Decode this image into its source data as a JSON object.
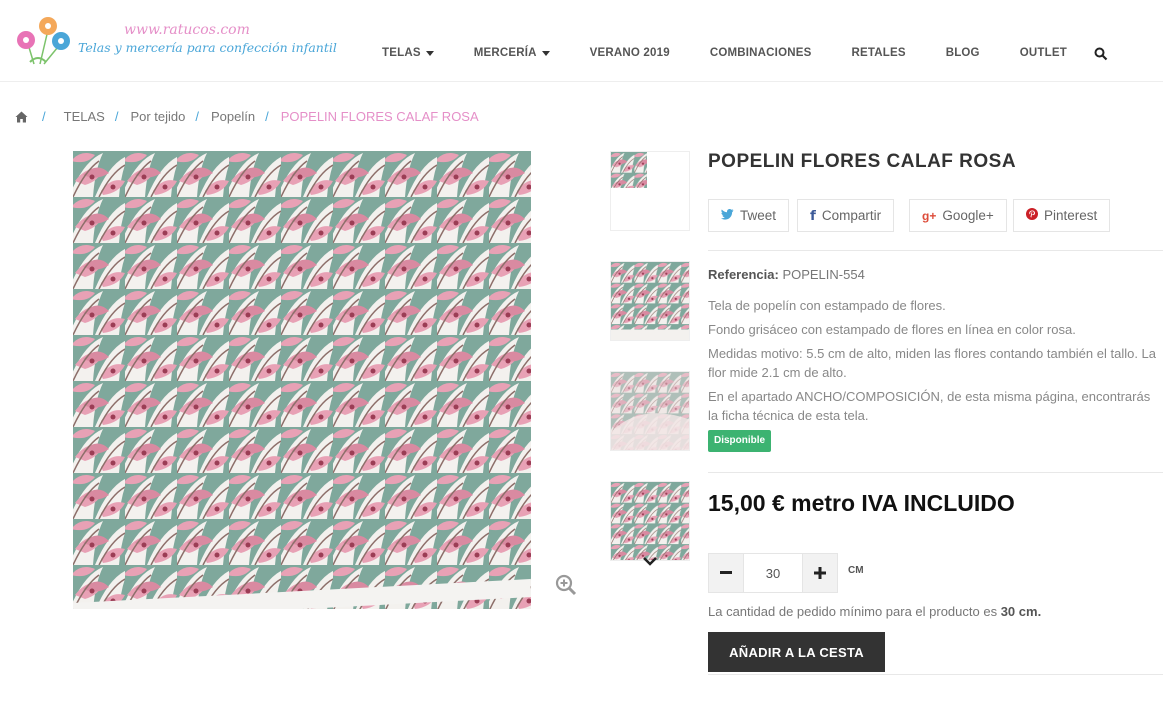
{
  "header": {
    "logo_url": "www.ratucos.com",
    "logo_tagline": "Telas y mercería para confección infantil",
    "nav": [
      {
        "label": "TELAS",
        "dropdown": true
      },
      {
        "label": "MERCERÍA",
        "dropdown": true
      },
      {
        "label": "VERANO 2019",
        "dropdown": false
      },
      {
        "label": "COMBINACIONES",
        "dropdown": false
      },
      {
        "label": "RETALES",
        "dropdown": false
      },
      {
        "label": "BLOG",
        "dropdown": false
      },
      {
        "label": "OUTLET",
        "dropdown": false
      }
    ],
    "search_icon": "search-icon"
  },
  "breadcrumb": {
    "home_icon": "home-icon",
    "sep": "/",
    "items": [
      "TELAS",
      "Por tejido",
      "Popelín"
    ],
    "current": "POPELIN FLORES CALAF ROSA"
  },
  "product": {
    "title": "POPELIN FLORES CALAF ROSA",
    "share": [
      {
        "icon": "twitter-icon",
        "label": "Tweet",
        "glyph": "🐦"
      },
      {
        "icon": "facebook-icon",
        "label": "Compartir",
        "glyph": "f"
      },
      {
        "icon": "google-plus-icon",
        "label": "Google+",
        "glyph": "g+"
      },
      {
        "icon": "pinterest-icon",
        "label": "Pinterest",
        "glyph": "P"
      }
    ],
    "reference_label": "Referencia:",
    "reference_value": "POPELIN-554",
    "description": [
      "Tela de popelín con estampado de flores.",
      "Fondo grisáceo con estampado de flores en línea en color rosa.",
      "Medidas motivo: 5.5 cm de alto, miden las flores contando también el tallo. La flor mide 2.1 cm de alto.",
      "En el apartado ANCHO/COMPOSICIÓN, de esta misma página, encontrarás la ficha técnica de esta tela."
    ],
    "availability": "Disponible",
    "price": "15,00 € metro IVA INCLUIDO",
    "quantity": "30",
    "quantity_unit": "CM",
    "min_note_prefix": "La cantidad de pedido mínimo para el producto es ",
    "min_note_value": "30 cm.",
    "add_to_cart": "AÑADIR A LA CESTA"
  },
  "colors": {
    "pink_accent": "#e58fc8",
    "blue_accent": "#4aa6d8",
    "fabric_pink": "#e8a1b5",
    "fabric_teal": "#7fa89c",
    "available_green": "#3cb371"
  }
}
